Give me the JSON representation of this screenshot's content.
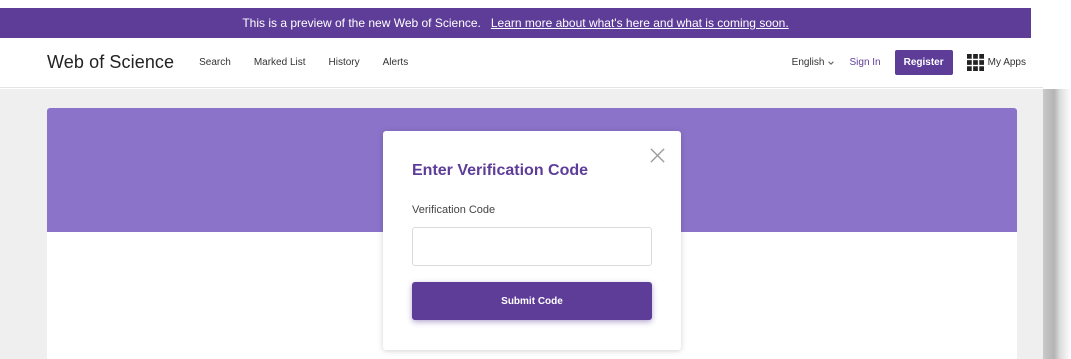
{
  "banner": {
    "text": "This is a preview of the new Web of Science.",
    "link": "Learn more about what's here and what is coming soon."
  },
  "header": {
    "brand": "Web of Science",
    "nav": [
      {
        "label": "Search"
      },
      {
        "label": "Marked List"
      },
      {
        "label": "History"
      },
      {
        "label": "Alerts"
      }
    ],
    "language": "English",
    "sign_in": "Sign In",
    "register": "Register",
    "my_apps": "My Apps"
  },
  "modal": {
    "title": "Enter Verification Code",
    "field_label": "Verification Code",
    "input_value": "",
    "input_placeholder": "",
    "submit_label": "Submit Code"
  },
  "icons": {
    "close": "close-icon",
    "language_chevron": "chevron-down-icon",
    "apps": "grid-icon"
  },
  "colors": {
    "brand_purple": "#5e3d99",
    "hero_purple": "#8a73c9",
    "page_background": "#efefef"
  }
}
